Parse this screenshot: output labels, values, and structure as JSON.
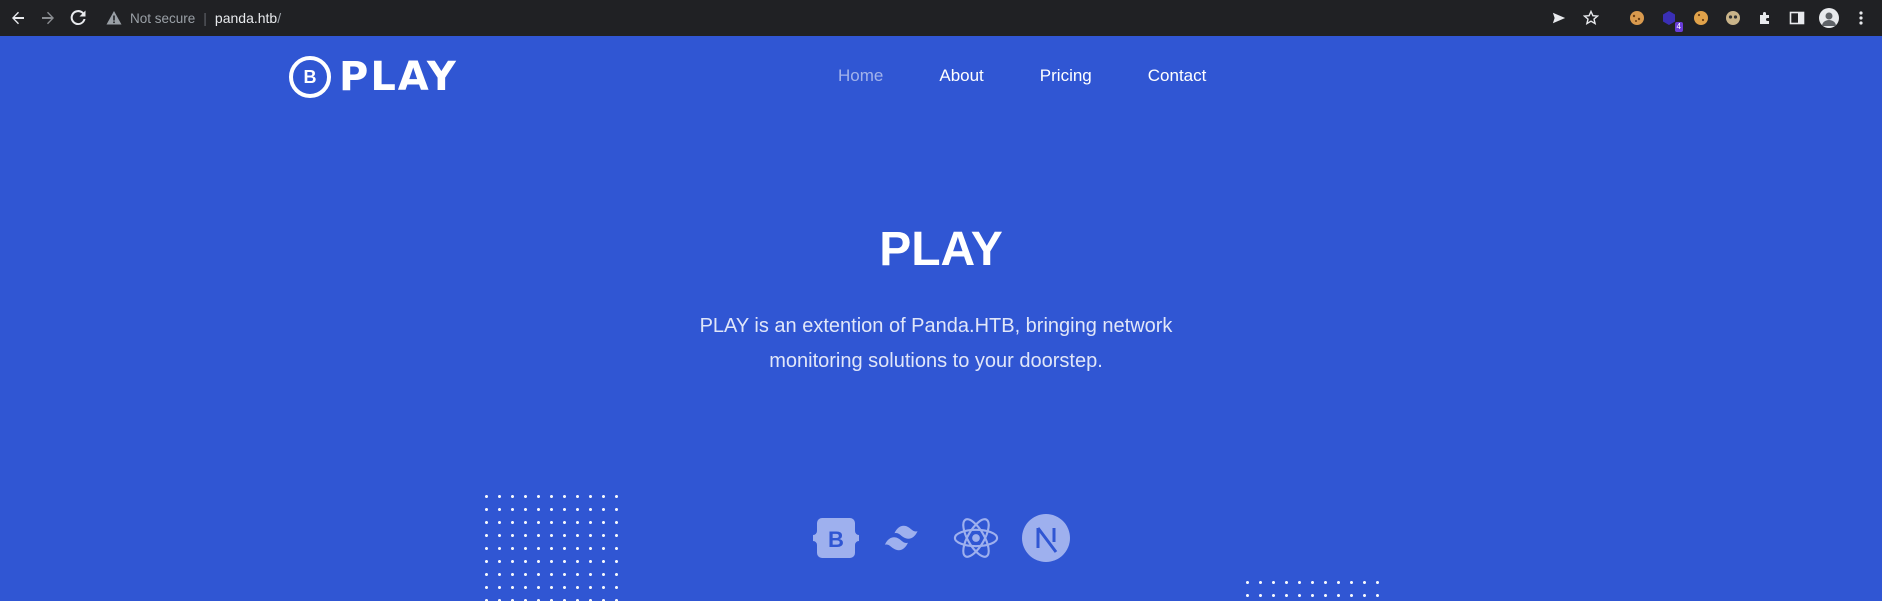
{
  "browser": {
    "security_label": "Not secure",
    "url_host": "panda.htb",
    "url_path": "/",
    "extension_badge": "4"
  },
  "site": {
    "logo_letter": "B",
    "logo_text": "PLAY",
    "nav": [
      {
        "label": "Home",
        "active": true
      },
      {
        "label": "About",
        "active": false
      },
      {
        "label": "Pricing",
        "active": false
      },
      {
        "label": "Contact",
        "active": false
      }
    ]
  },
  "hero": {
    "title": "PLAY",
    "description": "PLAY is an extention of Panda.HTB, bringing network monitoring solutions to your doorstep.",
    "tech_icons": [
      "bootstrap-icon",
      "tailwind-icon",
      "react-icon",
      "nextjs-icon"
    ]
  },
  "colors": {
    "primary": "#3056d3",
    "chrome": "#202124"
  }
}
